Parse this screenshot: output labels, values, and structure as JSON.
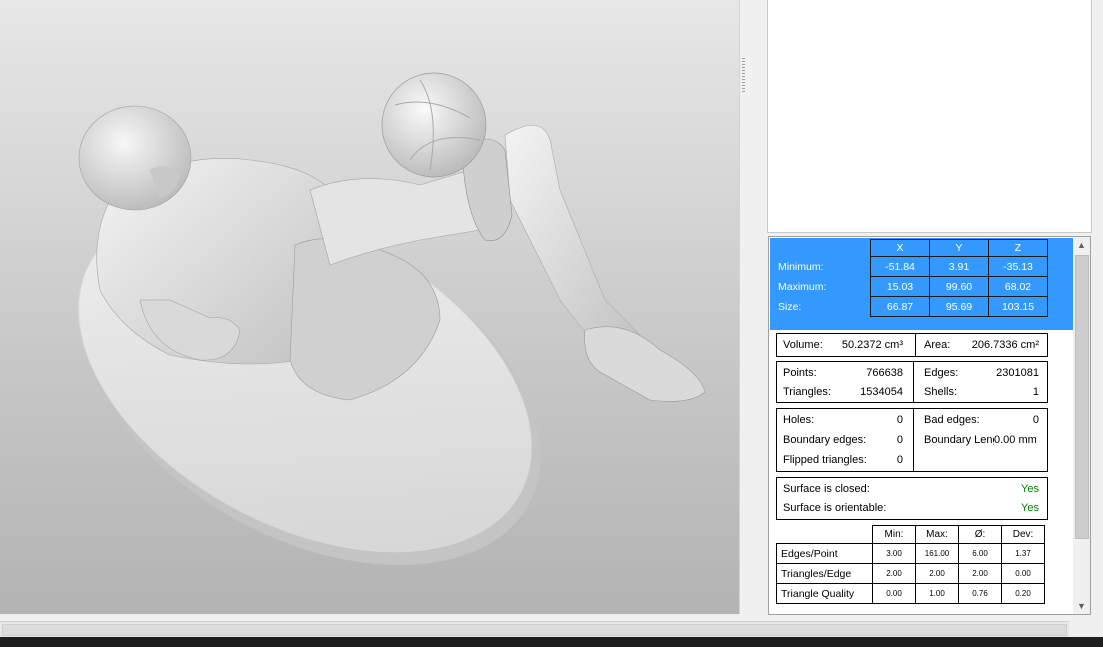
{
  "bounding_box": {
    "headers": [
      "",
      "X",
      "Y",
      "Z"
    ],
    "rows": [
      {
        "label": "Minimum:",
        "x": "-51.84",
        "y": "3.91",
        "z": "-35.13"
      },
      {
        "label": "Maximum:",
        "x": "15.03",
        "y": "99.60",
        "z": "68.02"
      },
      {
        "label": "Size:",
        "x": "66.87",
        "y": "95.69",
        "z": "103.15"
      }
    ]
  },
  "volume": {
    "label": "Volume:",
    "value": "50.2372 cm³"
  },
  "area": {
    "label": "Area:",
    "value": "206.7336 cm²"
  },
  "points": {
    "label": "Points:",
    "value": "766638"
  },
  "edges": {
    "label": "Edges:",
    "value": "2301081"
  },
  "triangles": {
    "label": "Triangles:",
    "value": "1534054"
  },
  "shells": {
    "label": "Shells:",
    "value": "1"
  },
  "holes": {
    "label": "Holes:",
    "value": "0"
  },
  "bad_edges": {
    "label": "Bad edges:",
    "value": "0"
  },
  "boundary_edges": {
    "label": "Boundary edges:",
    "value": "0"
  },
  "boundary_length": {
    "label": "Boundary Leng",
    "value": "0.00 mm"
  },
  "flipped_triangles": {
    "label": "Flipped triangles:",
    "value": "0"
  },
  "surface_closed": {
    "label": "Surface is closed:",
    "value": "Yes"
  },
  "surface_orientable": {
    "label": "Surface is orientable:",
    "value": "Yes"
  },
  "statistics": {
    "headers": [
      "Min:",
      "Max:",
      "Ø:",
      "Dev:"
    ],
    "rows": [
      {
        "label": "Edges/Point",
        "values": [
          "3.00",
          "161.00",
          "6.00",
          "1.37"
        ]
      },
      {
        "label": "Triangles/Edge",
        "values": [
          "2.00",
          "2.00",
          "2.00",
          "0.00"
        ]
      },
      {
        "label": "Triangle Quality",
        "values": [
          "0.00",
          "1.00",
          "0.76",
          "0.20"
        ]
      }
    ]
  },
  "colors": {
    "selection": "#3399ff",
    "ok": "#008000"
  }
}
